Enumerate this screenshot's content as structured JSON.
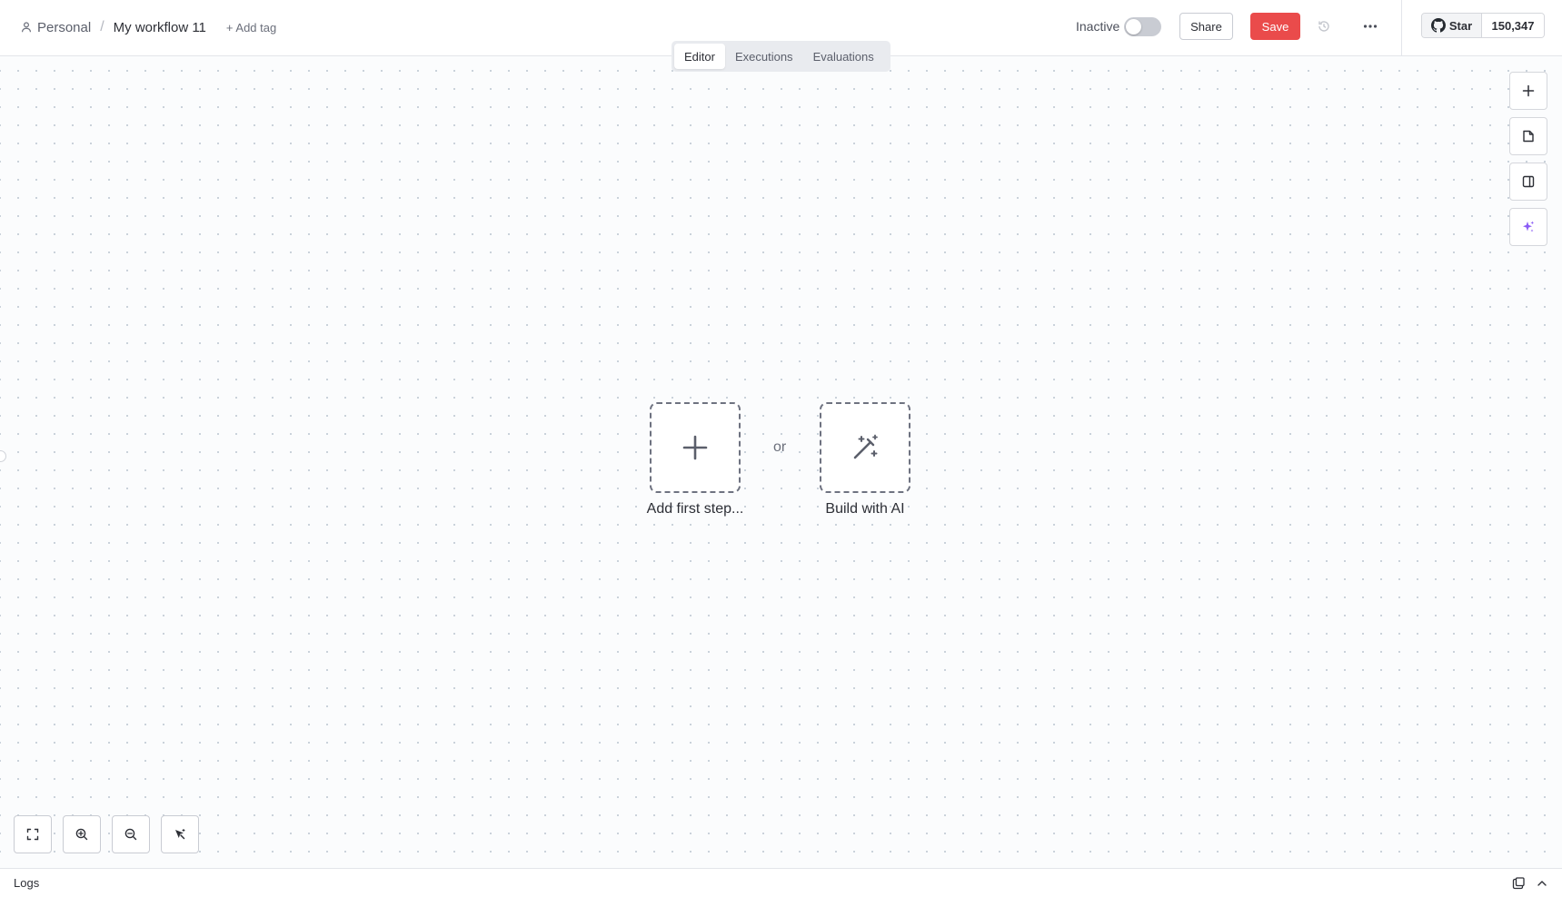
{
  "header": {
    "project": "Personal",
    "separator": "/",
    "workflow_name": "My workflow 11",
    "add_tag_label": "+ Add tag",
    "status_label": "Inactive",
    "share_label": "Share",
    "save_label": "Save",
    "github": {
      "star_label": "Star",
      "star_count": "150,347"
    }
  },
  "tabs": [
    {
      "label": "Editor",
      "active": true
    },
    {
      "label": "Executions",
      "active": false
    },
    {
      "label": "Evaluations",
      "active": false
    }
  ],
  "canvas": {
    "add_first_step_label": "Add first step...",
    "or_label": "or",
    "build_with_ai_label": "Build with AI"
  },
  "right_toolbar": [
    "plus-icon",
    "sticky-note-icon",
    "panel-icon",
    "sparkle-icon"
  ],
  "zoom_controls": [
    "fit-view-icon",
    "zoom-in-icon",
    "zoom-out-icon",
    "tidy-up-icon"
  ],
  "logs": {
    "label": "Logs"
  },
  "colors": {
    "save": "#ea4b4b",
    "ai_accent": "#8b5cf6",
    "toggle_off": "#c9ccd3"
  }
}
